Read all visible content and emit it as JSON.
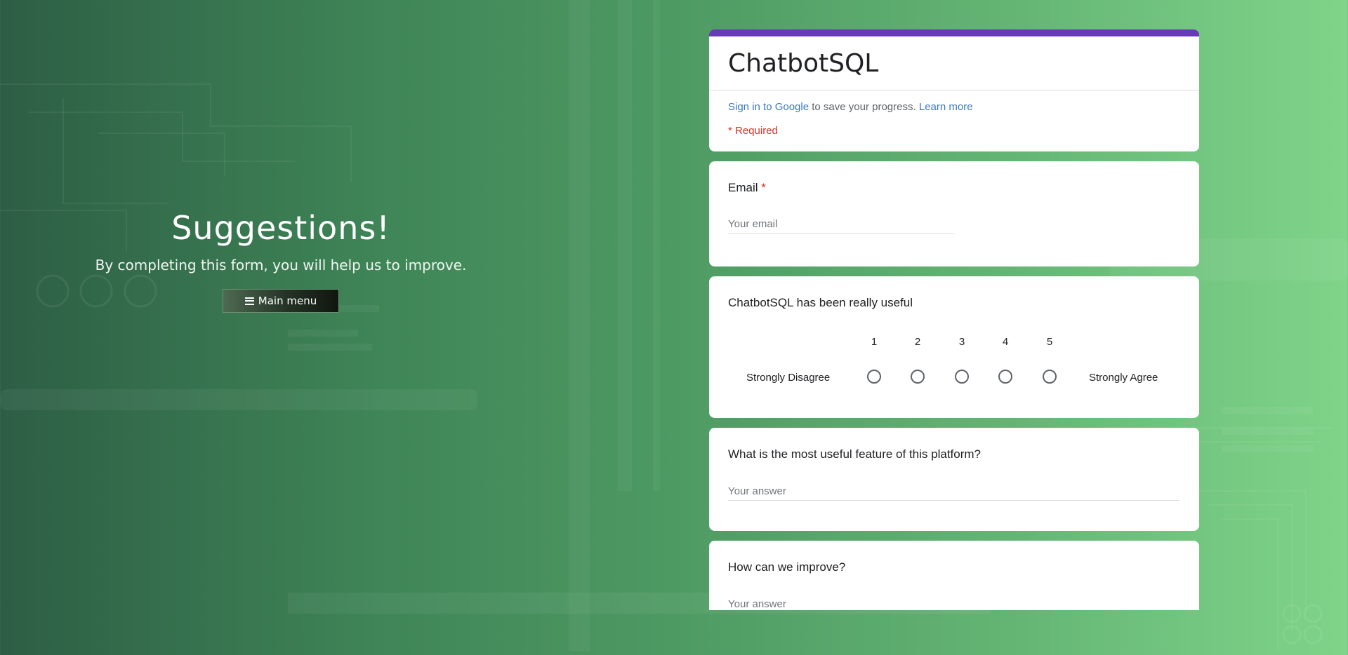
{
  "hero": {
    "title": "Suggestions!",
    "subtitle": "By completing this form, you will help us to improve.",
    "menu_button_label": "Main menu"
  },
  "form": {
    "title": "ChatbotSQL",
    "accent_color": "#673ab7",
    "signin_link": "Sign in to Google",
    "signin_text": " to save your progress. ",
    "learn_more_link": "Learn more",
    "required_note": "* Required",
    "email": {
      "label": "Email",
      "required_mark": "*",
      "placeholder": "Your email"
    },
    "rating": {
      "question": "ChatbotSQL has been really useful",
      "scale": [
        "1",
        "2",
        "3",
        "4",
        "5"
      ],
      "min_label": "Strongly Disagree",
      "max_label": "Strongly Agree"
    },
    "feature": {
      "question": "What is the most useful feature of this platform?",
      "placeholder": "Your answer"
    },
    "improve": {
      "question": "How can we improve?",
      "placeholder": "Your answer"
    }
  }
}
